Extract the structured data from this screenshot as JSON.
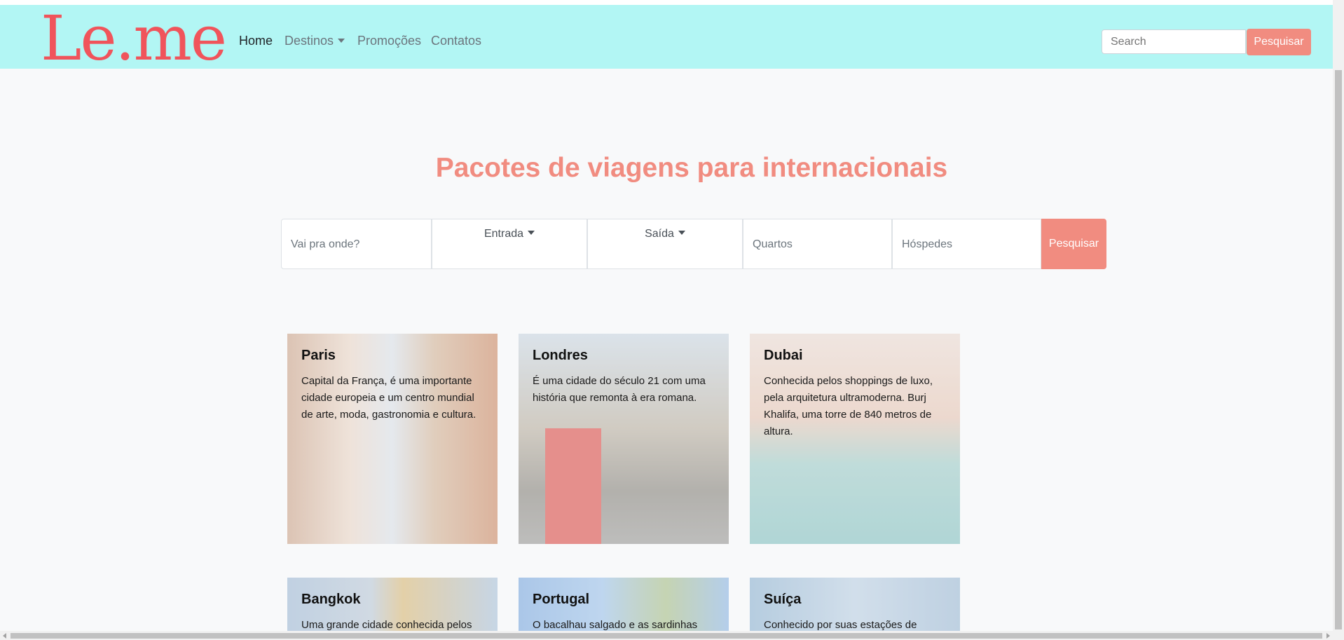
{
  "brand": "Le.me",
  "nav": {
    "home": "Home",
    "destinos": "Destinos",
    "promocoes": "Promoções",
    "contatos": "Contatos",
    "search_placeholder": "Search",
    "search_button": "Pesquisar"
  },
  "hero": {
    "title": "Pacotes de viagens para internacionais"
  },
  "booking": {
    "destination_placeholder": "Vai pra onde?",
    "entrada": "Entrada",
    "saida": "Saída",
    "quartos_placeholder": "Quartos",
    "hospedes_placeholder": "Hóspedes",
    "submit": "Pesquisar"
  },
  "cards": [
    {
      "title": "Paris",
      "text": "Capital da França, é uma importante cidade europeia e um centro mundial de arte, moda, gastronomia e cultura."
    },
    {
      "title": "Londres",
      "text": "É uma cidade do século 21 com uma história que remonta à era romana."
    },
    {
      "title": "Dubai",
      "text": "Conhecida pelos shoppings de luxo, pela arquitetura ultramoderna. Burj Khalifa, uma torre de 840 metros de altura."
    },
    {
      "title": "Bangkok",
      "text": "Uma grande cidade conhecida pelos"
    },
    {
      "title": "Portugal",
      "text": "O bacalhau salgado e as sardinhas"
    },
    {
      "title": "Suíça",
      "text": "Conhecido por suas estações de"
    }
  ],
  "colors": {
    "navbar": "#b2f6f4",
    "brand": "#f0545b",
    "accent": "#f18c80"
  }
}
